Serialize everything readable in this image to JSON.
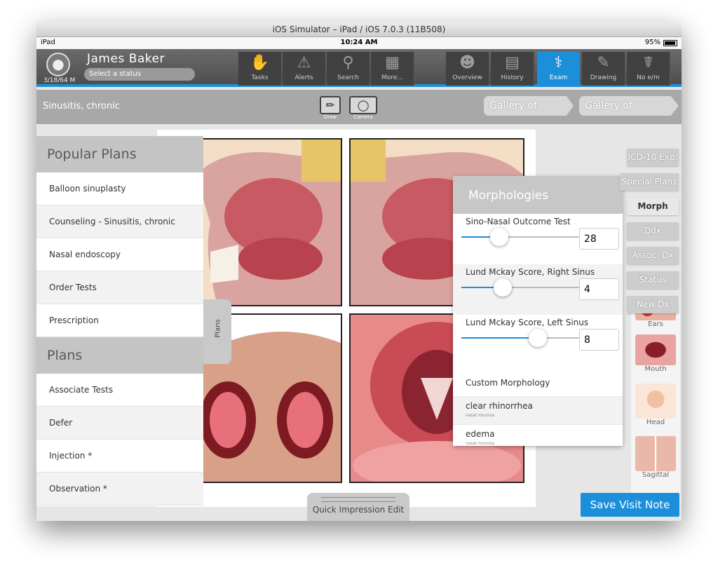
{
  "window": {
    "title": "iOS Simulator – iPad / iOS 7.0.3 (11B508)"
  },
  "status_bar": {
    "carrier": "iPad",
    "time": "10:24 AM",
    "battery": "95%"
  },
  "patient": {
    "name": "James  Baker",
    "dob": "3/18/64 M",
    "status_placeholder": "Select a status"
  },
  "nav_left": [
    {
      "label": "Tasks",
      "icon": "hand-icon"
    },
    {
      "label": "Alerts",
      "icon": "alert-icon"
    },
    {
      "label": "Search",
      "icon": "search-icon"
    },
    {
      "label": "More...",
      "icon": "hierarchy-icon"
    }
  ],
  "nav_right": [
    {
      "label": "Overview",
      "icon": "head-icon"
    },
    {
      "label": "History",
      "icon": "book-icon"
    },
    {
      "label": "Exam",
      "icon": "stethoscope-icon",
      "active": true
    },
    {
      "label": "Drawing",
      "icon": "palette-icon"
    },
    {
      "label": "No e/m",
      "icon": "caduceus-icon"
    }
  ],
  "subbar": {
    "diagnosis": "Sinusitis, chronic",
    "tools": {
      "draw": "Draw",
      "camera": "Camera"
    },
    "gallery_findings": "Gallery of Findings",
    "gallery_impressions": "Gallery of Impressions"
  },
  "popular_plans": {
    "title": "Popular Plans",
    "items": [
      "Balloon sinuplasty",
      "Counseling - Sinusitis, chronic",
      "Nasal endoscopy",
      "Order Tests",
      "Prescription"
    ]
  },
  "plans": {
    "title": "Plans",
    "items": [
      "Associate Tests",
      "Defer",
      "Injection *",
      "Observation *"
    ]
  },
  "plans_tab": "Plans",
  "morphologies": {
    "title": "Morphologies",
    "sliders": [
      {
        "label": "Sino-Nasal Outcome Test",
        "value": "28",
        "fraction": 0.32
      },
      {
        "label": "Lund Mckay Score, Right Sinus",
        "value": "4",
        "fraction": 0.35
      },
      {
        "label": "Lund Mckay Score, Left Sinus",
        "value": "8",
        "fraction": 0.65
      }
    ],
    "custom_label": "Custom Morphology",
    "custom_items": [
      {
        "text": "clear rhinorrhea",
        "sub": "nasal mucosa"
      },
      {
        "text": "edema",
        "sub": "nasal mucosa"
      }
    ]
  },
  "right_buttons": [
    "ICD-10 Exp.",
    "Special Plans",
    "Morph",
    "Ddx",
    "Assoc. Dx",
    "Status",
    "New Dx"
  ],
  "thumbnails": [
    "Ears",
    "Mouth",
    "Head",
    "Sagittal"
  ],
  "quick_impression": "Quick Impression Edit",
  "save_button": "Save Visit Note",
  "colors": {
    "accent": "#1c8fdb",
    "navbar": "#555555",
    "panel_header": "#c4c4c4"
  }
}
